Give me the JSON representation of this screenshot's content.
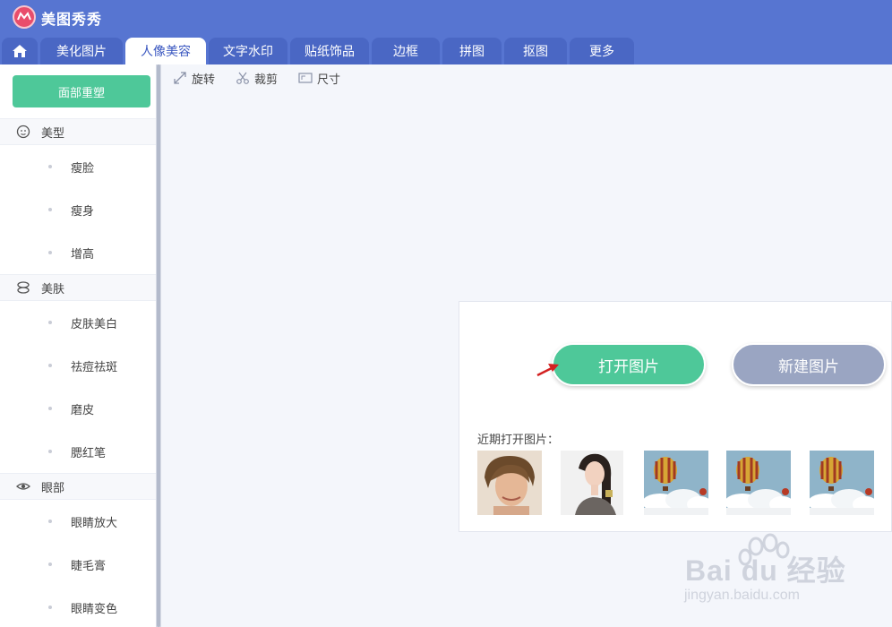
{
  "app": {
    "name": "美图秀秀",
    "logo_mark": "meitu"
  },
  "tabs": [
    {
      "label": "美化图片"
    },
    {
      "label": "人像美容"
    },
    {
      "label": "文字水印"
    },
    {
      "label": "贴纸饰品"
    },
    {
      "label": "边框"
    },
    {
      "label": "拼图"
    },
    {
      "label": "抠图"
    },
    {
      "label": "更多"
    }
  ],
  "active_tab": "人像美容",
  "sidebar": {
    "reset_label": "面部重塑",
    "sections": [
      {
        "title": "美型",
        "icon": "face-icon",
        "items": [
          "瘦脸",
          "瘦身",
          "增高"
        ]
      },
      {
        "title": "美肤",
        "icon": "skin-icon",
        "items": [
          "皮肤美白",
          "祛痘祛斑",
          "磨皮",
          "腮红笔"
        ]
      },
      {
        "title": "眼部",
        "icon": "eye-icon",
        "items": [
          "眼睛放大",
          "睫毛膏",
          "眼睛变色"
        ]
      }
    ]
  },
  "toolbar": {
    "rotate": "旋转",
    "crop": "裁剪",
    "size": "尺寸"
  },
  "open_panel": {
    "open_button": "打开图片",
    "new_button": "新建图片",
    "recent_label": "近期打开图片："
  },
  "watermark": {
    "brand": "Bai du 经验",
    "url": "jingyan.baidu.com"
  },
  "colors": {
    "header": "#5775d1",
    "accent_green": "#4ec899",
    "new_button": "#9aa5c2"
  }
}
